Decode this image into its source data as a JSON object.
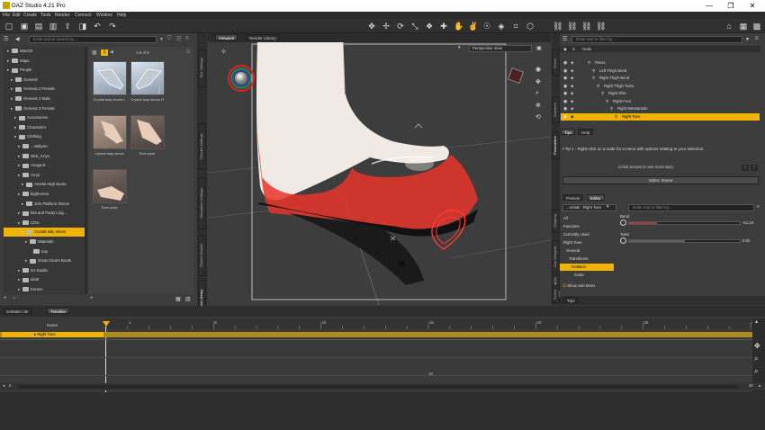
{
  "app": {
    "title": "DAZ Studio 4.21 Pro",
    "window_buttons": [
      "—",
      "❐",
      "✕"
    ]
  },
  "menu": [
    "File",
    "Edit",
    "Create",
    "Tools",
    "Render",
    "Connect",
    "Window",
    "Help"
  ],
  "content_library": {
    "search_placeholder": "Enter text to search by...",
    "tree": [
      {
        "label": "MacOS",
        "indent": 1,
        "sel": false
      },
      {
        "label": "Maps",
        "indent": 1,
        "sel": false
      },
      {
        "label": "People",
        "indent": 1,
        "sel": false
      },
      {
        "label": "Genesis",
        "indent": 2,
        "sel": false
      },
      {
        "label": "Genesis 2 Female",
        "indent": 2,
        "sel": false
      },
      {
        "label": "Genesis 2 Male",
        "indent": 2,
        "sel": false
      },
      {
        "label": "Genesis 3 Female",
        "indent": 2,
        "sel": false
      },
      {
        "label": "Accessories",
        "indent": 3,
        "sel": false
      },
      {
        "label": "Characters",
        "indent": 3,
        "sel": false
      },
      {
        "label": "Clothing",
        "indent": 3,
        "sel": false
      },
      {
        "label": "...Valkyrie-",
        "indent": 4,
        "sel": false
      },
      {
        "label": "3DS_Arryn",
        "indent": 4,
        "sel": false
      },
      {
        "label": "Anagord",
        "indent": 4,
        "sel": false
      },
      {
        "label": "Arryn",
        "indent": 4,
        "sel": false
      },
      {
        "label": "Amelia High Boots",
        "indent": 5,
        "sel": false
      },
      {
        "label": "bigthreens",
        "indent": 4,
        "sel": false
      },
      {
        "label": "10in Platform Ihsess",
        "indent": 5,
        "sel": false
      },
      {
        "label": "Bra and Panty Ling...",
        "indent": 4,
        "sel": false
      },
      {
        "label": "CDw",
        "indent": 4,
        "sel": false
      },
      {
        "label": "Crystal lady shoes",
        "indent": 5,
        "sel": true
      },
      {
        "label": "Materials",
        "indent": 6,
        "sel": false
      },
      {
        "label": "tray",
        "indent": 7,
        "sel": false
      },
      {
        "label": "Great Charm Boots",
        "indent": 6,
        "sel": false
      },
      {
        "label": "DJ-Studio",
        "indent": 4,
        "sel": false
      },
      {
        "label": "ds30",
        "indent": 4,
        "sel": false
      },
      {
        "label": "Eonem",
        "indent": 4,
        "sel": false
      }
    ],
    "page_label": "1-6 of 6",
    "thumbs": [
      {
        "label": "Crystal lady shoes L"
      },
      {
        "label": "Crystal lady shoes R"
      },
      {
        "label": "Crystal lady shoes"
      },
      {
        "label": "Feet pose"
      },
      {
        "label": "Toes pose"
      }
    ]
  },
  "left_vtabs": [
    "Tool Settings",
    "Render Settings",
    "Simulation Settings",
    "Shader Builder",
    "Content Library"
  ],
  "viewport": {
    "tabs": [
      "Viewport",
      "Render Library"
    ],
    "view_label": "Perspective View"
  },
  "scene": {
    "search_placeholder": "Enter text to filter by...",
    "header": "Node",
    "nodes": [
      {
        "label": "Pelvis",
        "indent": 0,
        "sel": false
      },
      {
        "label": "Left Thigh Bend",
        "indent": 1,
        "sel": false
      },
      {
        "label": "Right Thigh Bend",
        "indent": 1,
        "sel": false
      },
      {
        "label": "Right Thigh Twist",
        "indent": 2,
        "sel": false
      },
      {
        "label": "Right Shin",
        "indent": 3,
        "sel": false
      },
      {
        "label": "Right Foot",
        "indent": 4,
        "sel": false
      },
      {
        "label": "Right Metatarsals",
        "indent": 5,
        "sel": false
      },
      {
        "label": "Right Toes",
        "indent": 6,
        "sel": true
      }
    ]
  },
  "tips": {
    "tabs": [
      "Tips",
      "Help"
    ],
    "text": "Tip 1 - Right-click on a node for a menu with options relating to your selection.",
    "hint": "(Click arrows to see more tips)",
    "video": "Video: Scene"
  },
  "params": {
    "tabs": [
      "Presets",
      "Editor"
    ],
    "dropdown": "...emale : Right Toes",
    "filter_placeholder": "Enter text to filter by...",
    "list": [
      {
        "label": "All",
        "sel": false
      },
      {
        "label": "Favorites",
        "sel": false
      },
      {
        "label": "Currently Used",
        "sel": false
      },
      {
        "label": "Right Toes",
        "sel": false
      },
      {
        "label": "General",
        "sel": false
      },
      {
        "label": "Transforms",
        "sel": false
      },
      {
        "label": "Rotation",
        "sel": true
      },
      {
        "label": "Scale",
        "sel": false
      }
    ],
    "show_sub": "Show Sub Items",
    "sliders": [
      {
        "name": "Bend",
        "value": "-61.24",
        "fill": 0.25
      },
      {
        "name": "Twist",
        "value": "0.00",
        "fill": 0.5
      }
    ],
    "tips_tab": "Tips"
  },
  "right_vtabs": [
    "Scene",
    "Surfaces",
    "Parameters",
    "Shaping",
    "Aux Viewport",
    "Lights",
    "Scene Info"
  ],
  "timeline": {
    "tabs": [
      "aniMate Lite",
      "Timeline"
    ],
    "name_header": "Name",
    "track": "Right Toes",
    "ticks": [
      "1",
      "5",
      "10",
      "15",
      "20",
      "25",
      "30"
    ],
    "frame": "19",
    "start": "0",
    "end": "30"
  },
  "colors": {
    "accent": "#f0b400"
  }
}
